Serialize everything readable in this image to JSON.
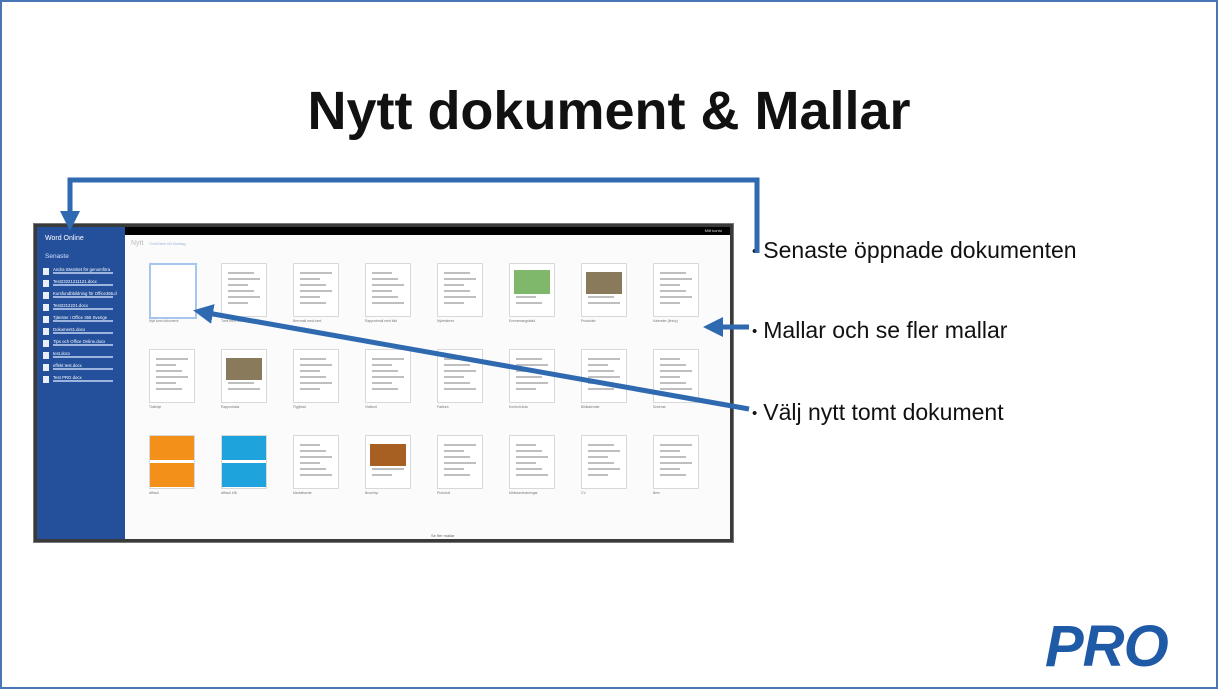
{
  "slide": {
    "title": "Nytt dokument & Mallar",
    "bullets": [
      "Senaste öppnade dokumenten",
      "Mallar och se fler mallar",
      "Välj nytt tomt dokument"
    ],
    "logo": "PRO"
  },
  "screenshot": {
    "topbar_account": "Mitt konto",
    "app_title": "Word Online",
    "recent_label": "Senaste",
    "recent_docs": [
      "Andra träsnittet för genomföra",
      "Test23221211121.docx",
      "Kursfundbbildning för Office365.d",
      "Test2212221.docx",
      "Tjänster i Office 365 Sverige",
      "Dokument1.docx",
      "Tips och Office Online.docx",
      "test.docx",
      "effekt test.docx",
      "Test PRO.docx"
    ],
    "crumb_new": "Nytt",
    "crumb_location": "OneDrive för företag",
    "templates": [
      "Nytt tomt dokument",
      "Tomt med rubrik",
      "Brevmall med tomt",
      "Rapportmall med bild",
      "Nyhetsbrev",
      "Evenemangsblad",
      "Produkter",
      "Kalender (årsvy)",
      "Tidslinje",
      "Rapportsida",
      "Flygblad",
      "Visitkort",
      "Faktura",
      "Kontroll-lista",
      "Bildkalender",
      "Schema",
      "Affisch",
      "Affisch blå",
      "Meddelande",
      "Broschyr",
      "Protokoll",
      "Mötesanteckningar",
      "CV",
      "Brev"
    ],
    "see_more": "Se fler mallar"
  },
  "colors": {
    "frame": "#4a76b8",
    "sidebar": "#234f9b",
    "arrow": "#2f6ab0",
    "logo": "#1e5aa5"
  }
}
